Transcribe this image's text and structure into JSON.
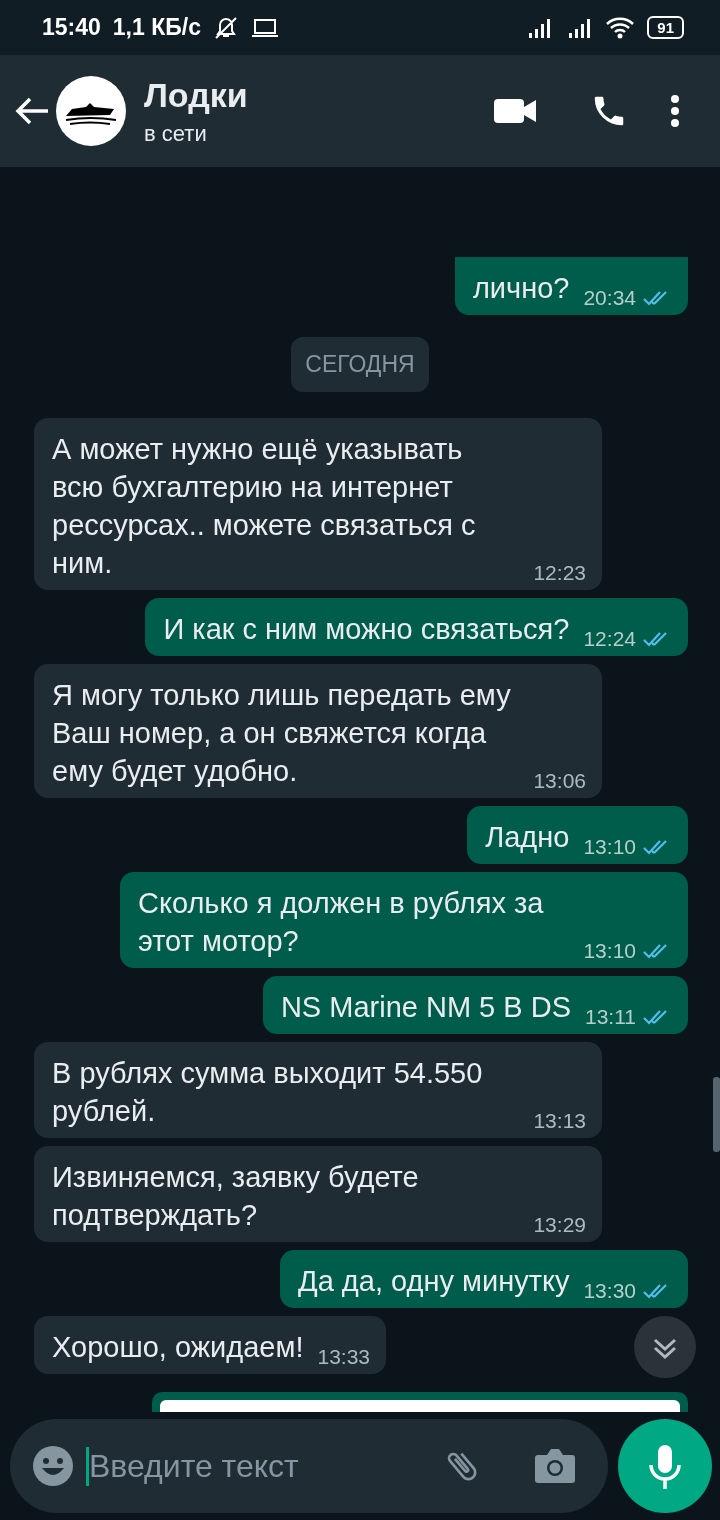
{
  "status_bar": {
    "time": "15:40",
    "speed": "1,1 КБ/с",
    "battery": "91"
  },
  "header": {
    "name": "Лодки",
    "status": "в сети"
  },
  "messages": [
    {
      "kind": "message",
      "outgoing": true,
      "text": "лично?",
      "time": "20:34",
      "read": true,
      "cut_top": true
    },
    {
      "kind": "date",
      "text": "СЕГОДНЯ"
    },
    {
      "kind": "message",
      "outgoing": false,
      "text": "А может нужно ещё указывать всю бухгалтерию на интернет рессурсах.. можете связаться с ним.",
      "time": "12:23"
    },
    {
      "kind": "message",
      "outgoing": true,
      "text": "И как с ним можно связаться?",
      "time": "12:24",
      "read": true
    },
    {
      "kind": "message",
      "outgoing": false,
      "text": "Я могу только лишь передать ему Ваш номер, а он свяжется когда ему будет удобно.",
      "time": "13:06"
    },
    {
      "kind": "message",
      "outgoing": true,
      "text": "Ладно",
      "time": "13:10",
      "read": true
    },
    {
      "kind": "message",
      "outgoing": true,
      "text": "Сколько я должен в рублях за этот мотор?",
      "time": "13:10",
      "read": true
    },
    {
      "kind": "message",
      "outgoing": true,
      "text": "NS Marine NM 5 B DS",
      "time": "13:11",
      "read": true
    },
    {
      "kind": "message",
      "outgoing": false,
      "text": "В рублях сумма выходит 54.550 рублей.",
      "time": "13:13"
    },
    {
      "kind": "message",
      "outgoing": false,
      "text": "Извиняемся, заявку будете подтверждать?",
      "time": "13:29"
    },
    {
      "kind": "message",
      "outgoing": true,
      "text": "Да да, одну минутку",
      "time": "13:30",
      "read": true
    },
    {
      "kind": "message",
      "outgoing": false,
      "text": "Хорошо, ожидаем!",
      "time": "13:33"
    },
    {
      "kind": "preview",
      "outgoing": true
    }
  ],
  "composer": {
    "placeholder": "Введите текст"
  }
}
